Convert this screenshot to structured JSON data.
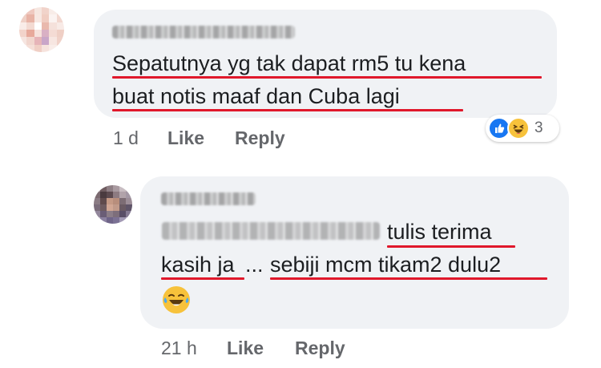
{
  "comments": [
    {
      "author": "",
      "text_lines": [
        "Sepatutnya yg tak dapat rm5 tu kena",
        "buat notis maaf dan Cuba lagi"
      ],
      "time": "1 d",
      "like_label": "Like",
      "reply_label": "Reply",
      "reactions": {
        "types": [
          "like-icon",
          "haha-icon"
        ],
        "count": "3"
      }
    },
    {
      "author": "",
      "text_line1": "tulis terima",
      "text_line2a": "kasih ja",
      "text_line2b": "...",
      "text_line2c": "sebiji mcm tikam2 dulu2",
      "emoji": "laughing-tears-emoji",
      "time": "21 h",
      "like_label": "Like",
      "reply_label": "Reply"
    }
  ],
  "colors": {
    "bubble": "#f0f2f5",
    "underline": "#e0182b",
    "meta_text": "#65676b",
    "like_blue": "#1877f2",
    "haha_yellow": "#f7c23b"
  }
}
